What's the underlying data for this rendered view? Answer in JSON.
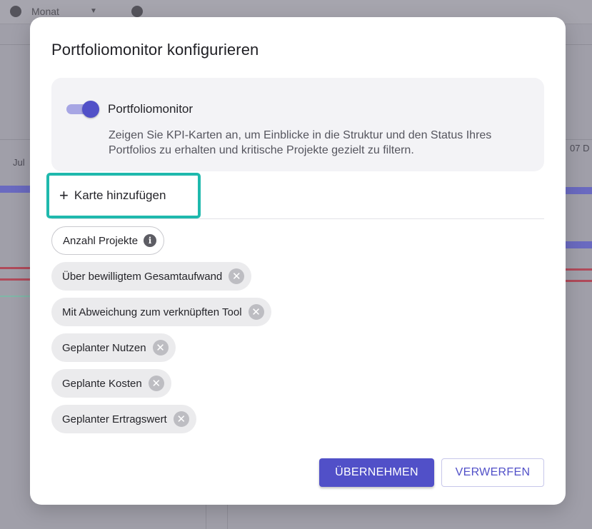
{
  "background": {
    "toolbar_label": "Monat",
    "left_label": "Jul",
    "right_label": "07 D"
  },
  "dialog": {
    "title": "Portfoliomonitor konfigurieren",
    "toggle": {
      "label": "Portfoliomonitor",
      "checked": true,
      "description": "Zeigen Sie KPI-Karten an, um Einblicke in die Struktur und den Status Ihres Portfolios zu erhalten und kritische Projekte gezielt zu filtern."
    },
    "add_card_label": "Karte hinzufügen",
    "chips": [
      {
        "label": "Anzahl Projekte",
        "icon": "info-icon",
        "removable": false
      },
      {
        "label": "Über bewilligtem Gesamtaufwand",
        "icon": "close-icon",
        "removable": true
      },
      {
        "label": "Mit Abweichung zum verknüpften Tool",
        "icon": "close-icon",
        "removable": true
      },
      {
        "label": "Geplanter Nutzen",
        "icon": "close-icon",
        "removable": true
      },
      {
        "label": "Geplante Kosten",
        "icon": "close-icon",
        "removable": true
      },
      {
        "label": "Geplanter Ertragswert",
        "icon": "close-icon",
        "removable": true
      }
    ],
    "apply_label": "ÜBERNEHMEN",
    "discard_label": "VERWERFEN"
  },
  "colors": {
    "accent": "#5150c8",
    "highlight": "#1fb9ad",
    "chip_bg": "#ebebed"
  }
}
